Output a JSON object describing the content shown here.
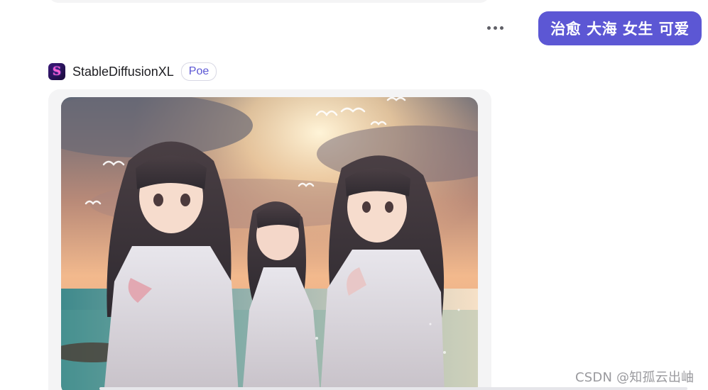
{
  "chat": {
    "user_message": "治愈 大海 女生 可爱",
    "more_icon": "more-horizontal-icon",
    "bot": {
      "name": "StableDiffusionXL",
      "badge": "Poe",
      "avatar_icon": "stable-diffusion-logo-icon",
      "image_alt": "Anime illustration of three girls in white dresses at the seaside at sunset with birds in the sky"
    }
  },
  "watermark": "CSDN @知孤云出岫",
  "colors": {
    "accent": "#5c57d4",
    "bubble_bg": "#f4f4f5",
    "text": "#1e1e22"
  }
}
